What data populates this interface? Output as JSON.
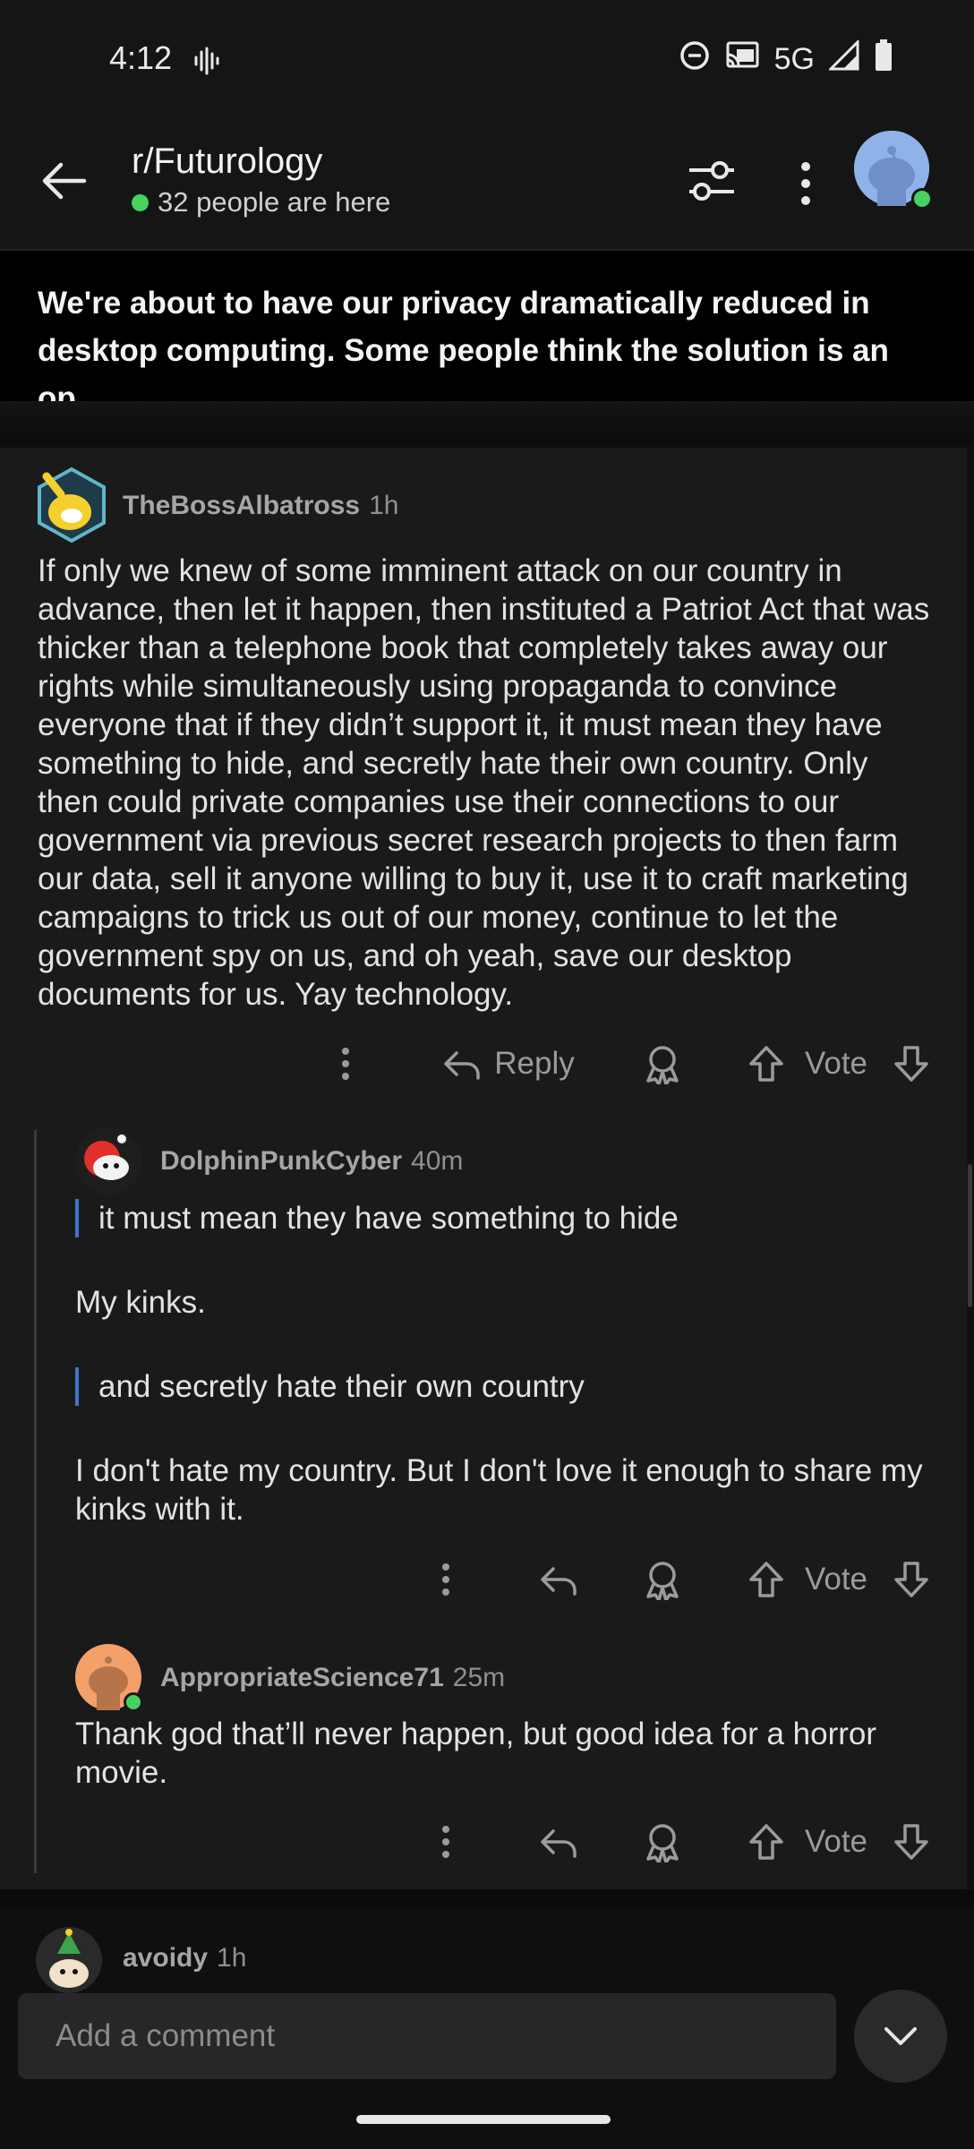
{
  "status_bar": {
    "time": "4:12",
    "network": "5G"
  },
  "header": {
    "subreddit": "r/Futurology",
    "online_count": "32 people are here"
  },
  "post": {
    "title": "We're about to have our privacy dramatically reduced in desktop computing. Some people think the solution is an op..."
  },
  "comments": [
    {
      "author": "TheBossAlbatross",
      "age": "1h",
      "body": "If only we knew of some imminent attack on our country in advance, then let it happen, then instituted a Patriot Act that was thicker than a telephone book that completely takes away our rights while simultaneously using propaganda to convince everyone that if they didn’t support it, it must mean they have something to hide, and secretly hate their own country. Only then could private companies use their connections to our government via previous secret research projects to then farm our data, sell it anyone willing to buy it, use it to craft marketing campaigns to trick us out of our money, continue to let the government spy on us, and oh yeah, save our desktop documents for us. Yay technology.",
      "reply_label": "Reply",
      "vote_label": "Vote"
    },
    {
      "author": "DolphinPunkCyber",
      "age": "40m",
      "quote1": "it must mean they have something to hide",
      "para1": "My kinks.",
      "quote2": "and secretly hate their own country",
      "para2": "I don't hate my country. But I don't love it enough to share my kinks with it.",
      "vote_label": "Vote"
    },
    {
      "author": "AppropriateScience71",
      "age": "25m",
      "body": "Thank god that’ll never happen, but good idea for a horror movie.",
      "vote_label": "Vote"
    },
    {
      "author": "avoidy",
      "age": "1h"
    }
  ],
  "composer": {
    "placeholder": "Add a comment"
  },
  "colors": {
    "background": "#1a1a1b",
    "online_green": "#46d160",
    "quote_bar": "#3d76c8"
  }
}
